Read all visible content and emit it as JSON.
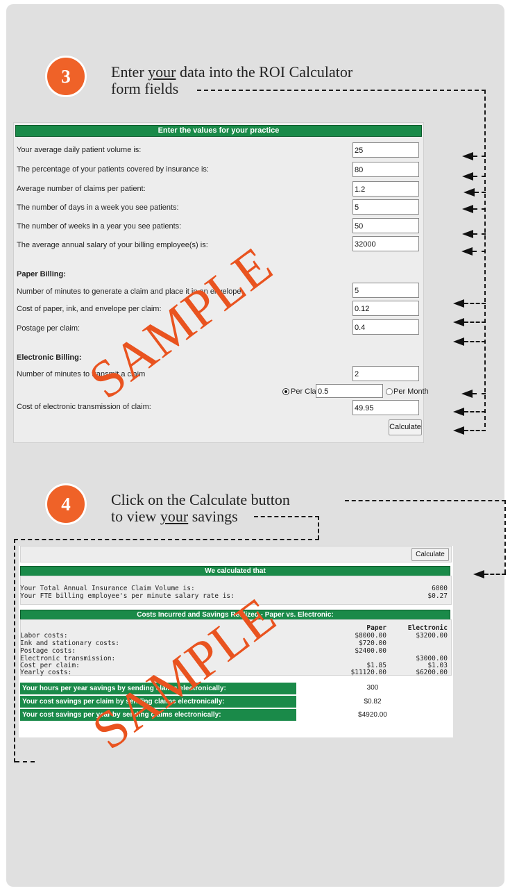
{
  "step3": {
    "number": "3",
    "line1_a": "Enter",
    "line1_your": "your",
    "line1_b": "data into the ROI Calculator",
    "line2": "form fields"
  },
  "step4": {
    "number": "4",
    "line1_a": "Click on the",
    "line1_calc": "Calculate",
    "line1_b": "button",
    "line2_a": "to view",
    "line2_your": "your",
    "line2_b": "savings"
  },
  "form": {
    "header": "Enter the values for your practice",
    "fields": [
      {
        "label": "Your average daily patient volume is:",
        "value": "25"
      },
      {
        "label": "The percentage of your patients covered by insurance is:",
        "value": "80"
      },
      {
        "label": "Average number of claims per patient:",
        "value": "1.2"
      },
      {
        "label": "The number of days in a week you see patients:",
        "value": "5"
      },
      {
        "label": "The number of weeks in a year you see patients:",
        "value": "50"
      },
      {
        "label": "The average annual salary of your billing employee(s) is:",
        "value": "32000"
      }
    ],
    "paper_heading": "Paper Billing:",
    "paper_fields": [
      {
        "label": "Number of minutes to generate a claim and place it in an envelope",
        "value": "5"
      },
      {
        "label": "Cost of paper, ink, and envelope per claim:",
        "value": "0.12"
      },
      {
        "label": "Postage per claim:",
        "value": "0.4"
      }
    ],
    "electronic_heading": "Electronic Billing:",
    "e_minutes_label": "Number of minutes to transmit a claim",
    "e_minutes_value": "2",
    "e_cost_label": "Cost of electronic transmission of claim:",
    "per_claim_label": "Per Claim",
    "per_claim_value": "0.5",
    "per_month_label": "Per Month",
    "per_month_value": "49.95",
    "calculate": "Calculate"
  },
  "results": {
    "calculate": "Calculate",
    "header1": "We calculated that",
    "volume_label": "Your Total Annual Insurance Claim Volume is:",
    "volume_value": "6000",
    "rate_label": "Your FTE billing employee's per minute salary rate is:",
    "rate_value": "$0.27",
    "header2": "Costs Incurred and Savings Realized - Paper vs. Electronic:",
    "col_paper": "Paper",
    "col_electronic": "Electronic",
    "rows": [
      {
        "label": "Labor costs:",
        "paper": "$8000.00",
        "electronic": "$3200.00"
      },
      {
        "label": "Ink and stationary costs:",
        "paper": "$720.00",
        "electronic": ""
      },
      {
        "label": "Postage costs:",
        "paper": "$2400.00",
        "electronic": ""
      },
      {
        "label": "Electronic transmission:",
        "paper": "",
        "electronic": "$3000.00"
      },
      {
        "label": "Cost per claim:",
        "paper": "$1.85",
        "electronic": "$1.03"
      },
      {
        "label": "Yearly costs:",
        "paper": "$11120.00",
        "electronic": "$6200.00"
      }
    ],
    "savings": [
      {
        "label": "Your hours per year savings by sending claims electronically:",
        "value": "300"
      },
      {
        "label": "Your cost savings per claim by sending claims electronically:",
        "value": "$0.82"
      },
      {
        "label": "Your cost savings per year by sending claims electronically:",
        "value": "$4920.00"
      }
    ]
  },
  "watermark": "SAMPLE",
  "colors": {
    "accent_orange": "#ef6228",
    "header_green": "#1a8a49",
    "watermark": "#e9531f"
  }
}
